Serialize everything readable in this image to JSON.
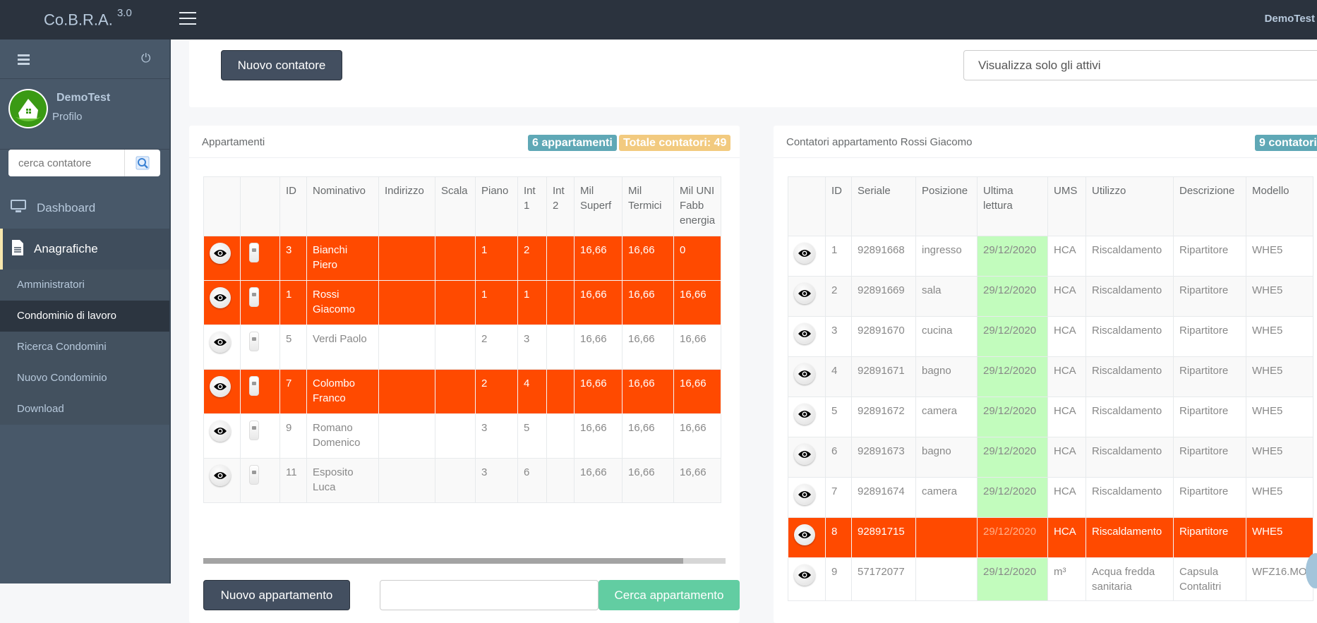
{
  "app": {
    "name": "Co.B.R.A.",
    "version": "3.0",
    "user": "DemoTest"
  },
  "sidebar": {
    "profile_name": "DemoTest",
    "profile_link": "Profilo",
    "search_placeholder": "cerca contatore",
    "nav": [
      {
        "label": "Dashboard",
        "icon": "monitor-icon"
      },
      {
        "label": "Anagrafiche",
        "icon": "document-icon"
      }
    ],
    "subnav": [
      {
        "label": "Amministratori",
        "active": false
      },
      {
        "label": "Condominio di lavoro",
        "active": true
      },
      {
        "label": "Ricerca Condomini",
        "active": false
      },
      {
        "label": "Nuovo Condominio",
        "active": false
      },
      {
        "label": "Download",
        "active": false
      }
    ]
  },
  "toolbar": {
    "new_meter_label": "Nuovo contatore",
    "filter_value": "Visualizza solo gli attivi"
  },
  "apartments": {
    "title": "Appartamenti",
    "badge_count": "6 appartamenti",
    "badge_total": "Totale contatori: 49",
    "columns": [
      "",
      "",
      "ID",
      "Nominativo",
      "Indirizzo",
      "Scala",
      "Piano",
      "Int 1",
      "Int 2",
      "Mil Superf",
      "Mil Termici",
      "Mil UNI Fabb energia"
    ],
    "rows": [
      {
        "id": "3",
        "name": "Bianchi Piero",
        "indirizzo": "",
        "scala": "",
        "piano": "1",
        "int1": "2",
        "int2": "",
        "mil_superf": "16,66",
        "mil_termici": "16,66",
        "mil_uni": "0",
        "highlight": true
      },
      {
        "id": "1",
        "name": "Rossi Giacomo",
        "indirizzo": "",
        "scala": "",
        "piano": "1",
        "int1": "1",
        "int2": "",
        "mil_superf": "16,66",
        "mil_termici": "16,66",
        "mil_uni": "16,66",
        "highlight": true
      },
      {
        "id": "5",
        "name": "Verdi Paolo",
        "indirizzo": "",
        "scala": "",
        "piano": "2",
        "int1": "3",
        "int2": "",
        "mil_superf": "16,66",
        "mil_termici": "16,66",
        "mil_uni": "16,66",
        "highlight": false
      },
      {
        "id": "7",
        "name": "Colombo Franco",
        "indirizzo": "",
        "scala": "",
        "piano": "2",
        "int1": "4",
        "int2": "",
        "mil_superf": "16,66",
        "mil_termici": "16,66",
        "mil_uni": "16,66",
        "highlight": true
      },
      {
        "id": "9",
        "name": "Romano Domenico",
        "indirizzo": "",
        "scala": "",
        "piano": "3",
        "int1": "5",
        "int2": "",
        "mil_superf": "16,66",
        "mil_termici": "16,66",
        "mil_uni": "16,66",
        "highlight": false
      },
      {
        "id": "11",
        "name": "Esposito Luca",
        "indirizzo": "",
        "scala": "",
        "piano": "3",
        "int1": "6",
        "int2": "",
        "mil_superf": "16,66",
        "mil_termici": "16,66",
        "mil_uni": "16,66",
        "highlight": false
      }
    ],
    "new_apartment_label": "Nuovo appartamento",
    "search_value": "",
    "search_button_label": "Cerca appartamento"
  },
  "meters": {
    "title": "Contatori appartamento Rossi Giacomo",
    "badge_count": "9 contatori",
    "columns": [
      "",
      "ID",
      "Seriale",
      "Posizione",
      "Ultima lettura",
      "UMS",
      "Utilizzo",
      "Descrizione",
      "Modello"
    ],
    "rows": [
      {
        "id": "1",
        "seriale": "92891668",
        "posizione": "ingresso",
        "ultima": "29/12/2020",
        "ums": "HCA",
        "utilizzo": "Riscaldamento",
        "descrizione": "Ripartitore",
        "modello": "WHE5",
        "highlight": false
      },
      {
        "id": "2",
        "seriale": "92891669",
        "posizione": "sala",
        "ultima": "29/12/2020",
        "ums": "HCA",
        "utilizzo": "Riscaldamento",
        "descrizione": "Ripartitore",
        "modello": "WHE5",
        "highlight": false
      },
      {
        "id": "3",
        "seriale": "92891670",
        "posizione": "cucina",
        "ultima": "29/12/2020",
        "ums": "HCA",
        "utilizzo": "Riscaldamento",
        "descrizione": "Ripartitore",
        "modello": "WHE5",
        "highlight": false
      },
      {
        "id": "4",
        "seriale": "92891671",
        "posizione": "bagno",
        "ultima": "29/12/2020",
        "ums": "HCA",
        "utilizzo": "Riscaldamento",
        "descrizione": "Ripartitore",
        "modello": "WHE5",
        "highlight": false
      },
      {
        "id": "5",
        "seriale": "92891672",
        "posizione": "camera",
        "ultima": "29/12/2020",
        "ums": "HCA",
        "utilizzo": "Riscaldamento",
        "descrizione": "Ripartitore",
        "modello": "WHE5",
        "highlight": false
      },
      {
        "id": "6",
        "seriale": "92891673",
        "posizione": "bagno",
        "ultima": "29/12/2020",
        "ums": "HCA",
        "utilizzo": "Riscaldamento",
        "descrizione": "Ripartitore",
        "modello": "WHE5",
        "highlight": false
      },
      {
        "id": "7",
        "seriale": "92891674",
        "posizione": "camera",
        "ultima": "29/12/2020",
        "ums": "HCA",
        "utilizzo": "Riscaldamento",
        "descrizione": "Ripartitore",
        "modello": "WHE5",
        "highlight": false
      },
      {
        "id": "8",
        "seriale": "92891715",
        "posizione": "",
        "ultima": "29/12/2020",
        "ums": "HCA",
        "utilizzo": "Riscaldamento",
        "descrizione": "Ripartitore",
        "modello": "WHE5",
        "highlight": true
      },
      {
        "id": "9",
        "seriale": "57172077",
        "posizione": "",
        "ultima": "29/12/2020",
        "ums": "m³",
        "utilizzo": "Acqua fredda sanitaria",
        "descrizione": "Capsula Contalitri",
        "modello": "WFZ16.MO",
        "highlight": false
      }
    ]
  },
  "colors": {
    "highlight": "#ff4a00",
    "reading_ok": "#c2fcbd",
    "badge_info": "#5fa8b6",
    "badge_warning": "#f2ca7f",
    "sidebar": "#485869",
    "topbar": "#2b333e"
  }
}
